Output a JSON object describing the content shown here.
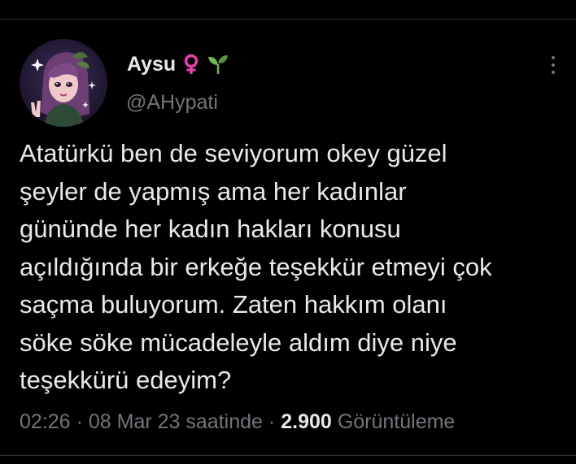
{
  "tweet": {
    "author": {
      "display_name": "Aysu",
      "handle": "@AHypati",
      "name_emojis": [
        "female-sign-icon",
        "seedling-icon"
      ],
      "avatar": "illustrated-avatar"
    },
    "text": "Atatürkü ben de seviyorum okey güzel\nşeyler de yapmış ama her kadınlar\ngününde her kadın hakları konusu\naçıldığında bir erkeğe teşekkür etmeyi çok\nsaçma buluyorum. Zaten hakkım olanı\nsöke söke mücadeleyle aldım diye niye\nteşekkürü edeyim?",
    "time": "02:26",
    "separator": "·",
    "date": "08 Mar 23 saatinde",
    "views_count": "2.900",
    "views_label": "Görüntüleme",
    "more_icon": "more-vertical-icon"
  },
  "colors": {
    "background": "#000000",
    "primary_text": "#e7e9ea",
    "secondary_text": "#71767b",
    "divider": "#2f3336",
    "female_sign": "#e63fb0",
    "seedling": "#78b159"
  }
}
